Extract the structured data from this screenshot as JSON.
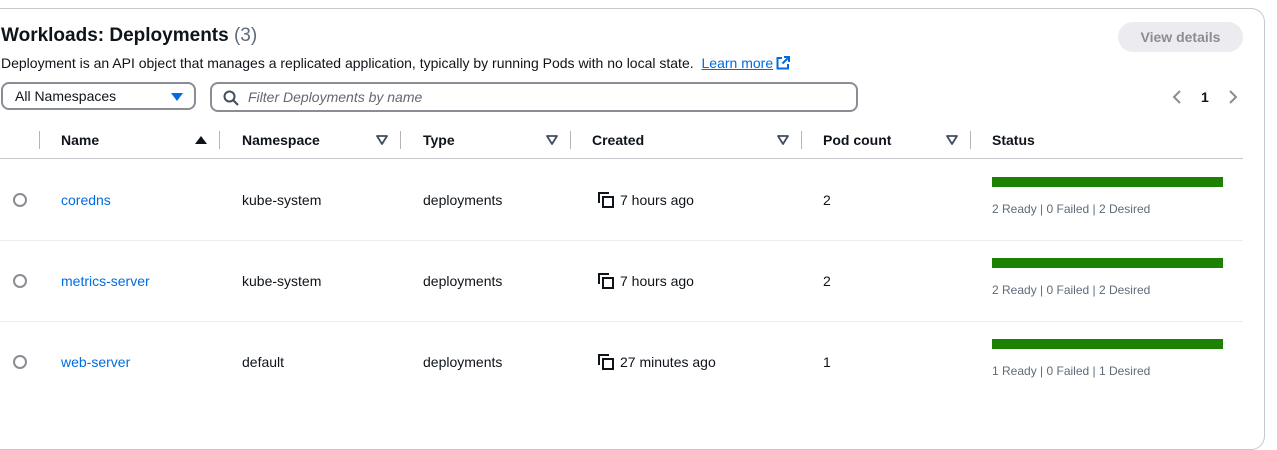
{
  "header": {
    "title": "Workloads: Deployments",
    "count": "(3)",
    "view_details": "View details",
    "description": "Deployment is an API object that manages a replicated application, typically by running Pods with no local state.",
    "learn_more": "Learn more"
  },
  "filters": {
    "namespace_selected": "All Namespaces",
    "search_placeholder": "Filter Deployments by name",
    "search_value": ""
  },
  "pagination": {
    "prev": "‹",
    "page": "1",
    "next": "›"
  },
  "columns": {
    "name": "Name",
    "namespace": "Namespace",
    "type": "Type",
    "created": "Created",
    "pod_count": "Pod count",
    "status": "Status"
  },
  "rows": [
    {
      "name": "coredns",
      "namespace": "kube-system",
      "type": "deployments",
      "created": "7 hours ago",
      "pod_count": "2",
      "ready_fraction": 1.0,
      "status": "2 Ready | 0 Failed | 2 Desired"
    },
    {
      "name": "metrics-server",
      "namespace": "kube-system",
      "type": "deployments",
      "created": "7 hours ago",
      "pod_count": "2",
      "ready_fraction": 1.0,
      "status": "2 Ready | 0 Failed | 2 Desired"
    },
    {
      "name": "web-server",
      "namespace": "default",
      "type": "deployments",
      "created": "27 minutes ago",
      "pod_count": "1",
      "ready_fraction": 1.0,
      "status": "1 Ready | 0 Failed | 1 Desired"
    }
  ],
  "colors": {
    "link": "#006ce0",
    "status_bar": "#1d8102"
  },
  "icons": [
    "external-link-icon",
    "caret-down-icon",
    "search-icon",
    "chevron-left-icon",
    "chevron-right-icon",
    "sort-ascending-icon",
    "sort-icon",
    "copy-icon"
  ]
}
